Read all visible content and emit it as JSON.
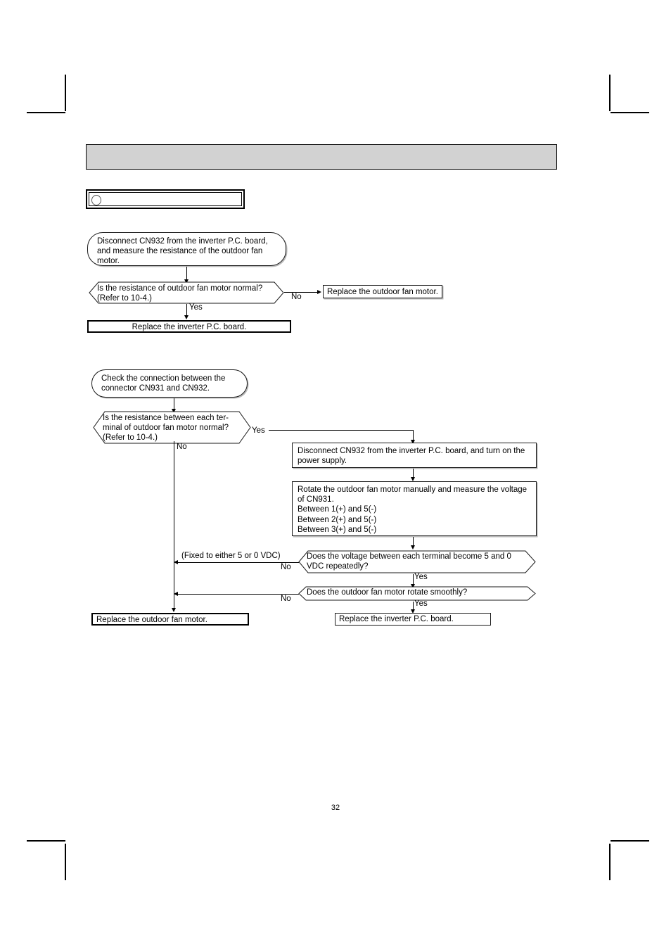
{
  "document": {
    "page_number": "32",
    "header_bar_color": "#d2d2d2",
    "section_label": ""
  },
  "flowchart_1": {
    "start": "Disconnect CN932 from the inverter P.C. board, and measure the resistance of the outdoor fan motor.",
    "decision": "Is the resistance of outdoor fan motor normal? (Refer to 10-4.)",
    "decision_line_1": "Is the resistance of outdoor fan motor normal?",
    "decision_line_2": "(Refer to 10-4.)",
    "label_no": "No",
    "label_yes": "Yes",
    "result_no": "Replace the outdoor fan motor.",
    "result_yes": "Replace the inverter P.C. board."
  },
  "flowchart_2": {
    "start": "Check the connection between the connector CN931 and CN932.",
    "start_line_1": "Check the connection between the",
    "start_line_2": "connector CN931 and CN932.",
    "decision_1": "Is the resistance between each terminal of outdoor fan motor normal? (Refer to 10-4.)",
    "decision_1_line_1": "Is the resistance between each ter-",
    "decision_1_line_2": "minal of outdoor fan motor normal?",
    "decision_1_line_3": "(Refer to 10-4.)",
    "decision_1_yes": "Yes",
    "decision_1_no": "No",
    "process_1": "Disconnect CN932 from the inverter P.C. board, and turn on the power supply.",
    "process_1_line_1": "Disconnect CN932 from the inverter P.C. board, and turn on the",
    "process_1_line_2": "power supply.",
    "process_2_line_1": "Rotate the outdoor fan motor manually and measure the voltage",
    "process_2_line_2": "of CN931.",
    "process_2_line_3": "Between 1(+) and 5(-)",
    "process_2_line_4": "Between 2(+) and 5(-)",
    "process_2_line_5": "Between 3(+) and 5(-)",
    "decision_2_line_1": "Does the voltage between each terminal become 5 and 0",
    "decision_2_line_2": "VDC repeatedly?",
    "decision_2_no": "No",
    "decision_2_no_note": "(Fixed to either 5 or 0 VDC)",
    "decision_2_yes": "Yes",
    "decision_3": "Does the outdoor fan motor rotate smoothly?",
    "decision_3_no": "No",
    "decision_3_yes": "Yes",
    "result_left": "Replace the outdoor fan motor.",
    "result_right": "Replace the inverter P.C. board."
  }
}
